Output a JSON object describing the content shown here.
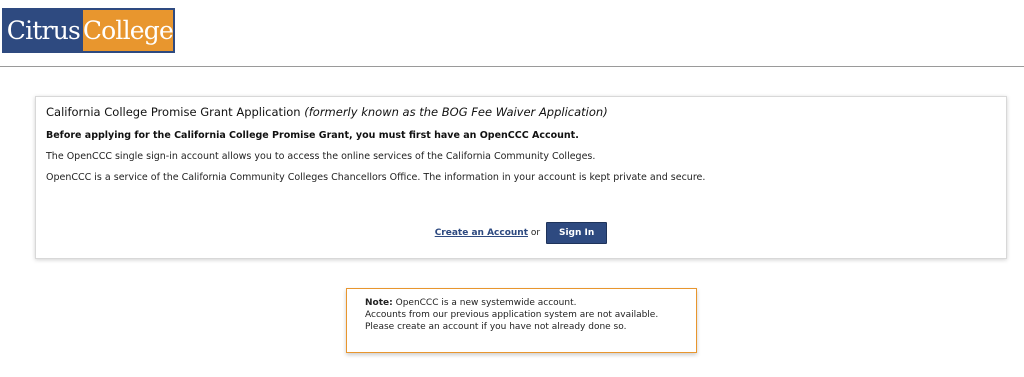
{
  "brand": {
    "logo_left": "Citrus",
    "logo_right": "College",
    "colors": {
      "navy": "#2e4a80",
      "orange": "#e8962e"
    }
  },
  "card": {
    "title_main": "California College Promise Grant Application",
    "title_italic": "(formerly known as the BOG Fee Waiver Application)",
    "strong": "Before applying for the California College Promise Grant, you must first have an OpenCCC Account.",
    "p1": "The OpenCCC single sign-in account allows you to access the online services of the California Community Colleges.",
    "p2": "OpenCCC is a service of the California Community Colleges Chancellors Office. The information in your account is kept private and secure."
  },
  "actions": {
    "create_account": "Create an Account",
    "or": "or",
    "sign_in": "Sign In"
  },
  "note": {
    "label": "Note:",
    "line1": "OpenCCC is a new systemwide account.",
    "line2": "Accounts from our previous application system are not available.",
    "line3": "Please create an account if you have not already done so."
  }
}
